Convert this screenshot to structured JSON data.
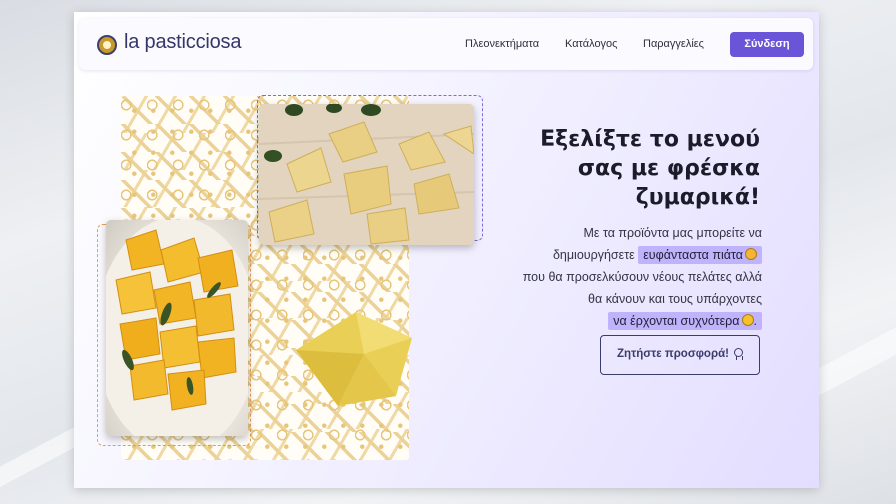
{
  "header": {
    "brand": "la pasticciosa",
    "nav": [
      "Πλεονεκτήματα",
      "Κατάλογος",
      "Παραγγελίες"
    ],
    "login_label": "Σύνδεση"
  },
  "hero": {
    "headline_lines": [
      "Εξελίξτε το μενού",
      "σας με φρέσκα",
      "ζυμαρικά!"
    ],
    "text_1": "Με τα προϊόντα μας μπορείτε να",
    "text_2": "δημιουργήσετε",
    "highlight_1": "ευφάνταστα πιάτα",
    "text_3": "που θα προσελκύσουν νέους πελάτες αλλά",
    "text_4": "θα κάνουν και τους υπάρχοντες",
    "highlight_2": "να έρχονται συχνότερα",
    "text_end": ".",
    "cta_label": "Ζητήστε προσφορά!",
    "cta_icon": "award-icon",
    "emoji_1": "drooling-face",
    "emoji_2": "smiling-face"
  },
  "colors": {
    "accent": "#6a55d8",
    "highlight": "#bfb3fb",
    "brand_text": "#35376a",
    "pattern": "#e7c67c",
    "dashed_orange": "#e79c57"
  }
}
